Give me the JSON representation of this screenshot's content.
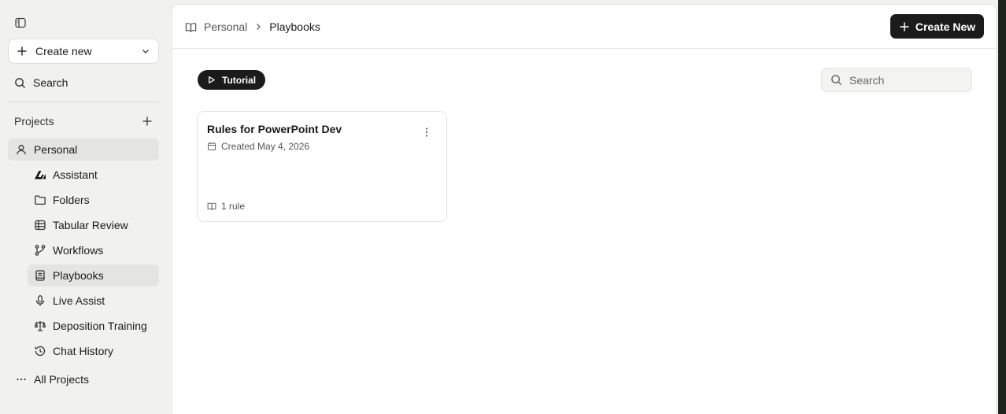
{
  "sidebar": {
    "create_new_label": "Create new",
    "search_label": "Search",
    "projects_label": "Projects",
    "personal_label": "Personal",
    "items": [
      {
        "label": "Assistant",
        "icon": "assistant-logo-icon"
      },
      {
        "label": "Folders",
        "icon": "folder-icon"
      },
      {
        "label": "Tabular Review",
        "icon": "table-icon"
      },
      {
        "label": "Workflows",
        "icon": "workflow-icon"
      },
      {
        "label": "Playbooks",
        "icon": "playbook-icon"
      },
      {
        "label": "Live Assist",
        "icon": "microphone-icon"
      },
      {
        "label": "Deposition Training",
        "icon": "scales-icon"
      },
      {
        "label": "Chat History",
        "icon": "history-icon"
      }
    ],
    "active_item": "Playbooks",
    "all_projects_label": "All Projects"
  },
  "header": {
    "breadcrumb": [
      "Personal",
      "Playbooks"
    ],
    "create_button_label": "Create New"
  },
  "main": {
    "tutorial_label": "Tutorial",
    "search_placeholder": "Search",
    "cards": [
      {
        "title": "Rules for PowerPoint Dev",
        "created": "Created May 4, 2026",
        "rule_count": "1 rule"
      }
    ]
  },
  "colors": {
    "accent_dark": "#1b1b1b",
    "sidebar_bg": "#f1f1f0",
    "active_bg": "#e4e4e2"
  }
}
